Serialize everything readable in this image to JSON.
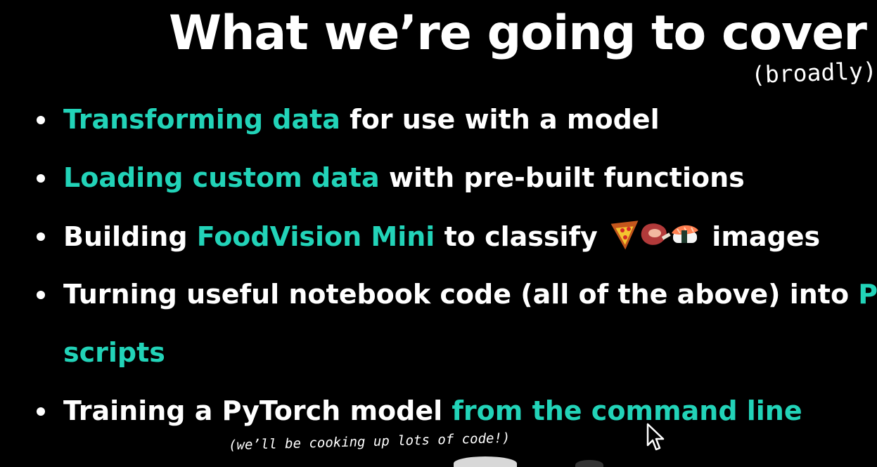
{
  "slide": {
    "title": "What we’re going to cover",
    "title_note": "(broadly)",
    "footer_note": "(we’ll be cooking up lots of code!)",
    "accent_color": "#22d3b8",
    "bullets": [
      {
        "highlight": "Transforming data",
        "rest": " for use with a model"
      },
      {
        "highlight": "Loading custom data",
        "rest": " with pre-built functions"
      },
      {
        "pre": "Building ",
        "highlight": "FoodVision Mini",
        "rest": " to classify",
        "icons": [
          "pizza-icon",
          "steak-icon",
          "sushi-icon"
        ],
        "post": " images"
      },
      {
        "pre": "Turning useful notebook code (all of the above) into ",
        "highlight": "Python",
        "highlight_wrap": "scripts"
      },
      {
        "pre": "Training a PyTorch model ",
        "highlight": "from the command line"
      }
    ]
  }
}
